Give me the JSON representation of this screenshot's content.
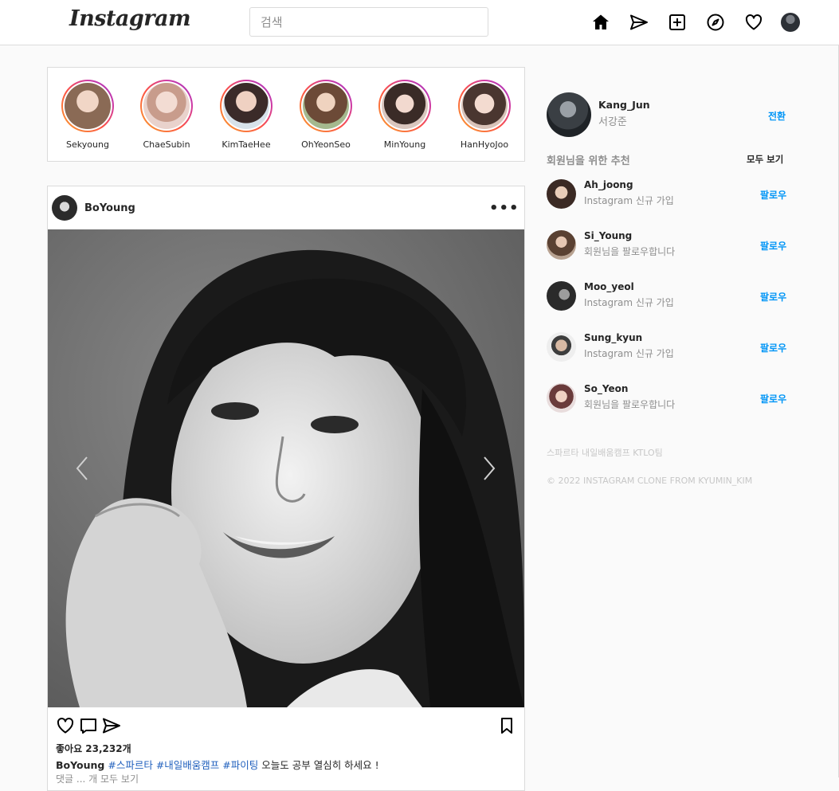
{
  "header": {
    "logo": "Instagram",
    "search_placeholder": "검색",
    "icons": [
      "home-icon",
      "direct-icon",
      "new-post-icon",
      "explore-icon",
      "activity-icon",
      "profile-avatar"
    ]
  },
  "stories": [
    {
      "name": "Sekyoung"
    },
    {
      "name": "ChaeSubin"
    },
    {
      "name": "KimTaeHee"
    },
    {
      "name": "OhYeonSeo"
    },
    {
      "name": "MinYoung"
    },
    {
      "name": "HanHyoJoo"
    }
  ],
  "post": {
    "username": "BoYoung",
    "more": "•••",
    "likes": "좋아요 23,232개",
    "caption_user": "BoYoung",
    "tags": [
      "#스파르타",
      "#내일배움캠프",
      "#파이팅"
    ],
    "caption_text": "오늘도 공부 열심히 하세요 !",
    "caption_line2": "댓글 ... 개 모두 보기"
  },
  "profile": {
    "username": "Kang_Jun",
    "name": "서강준",
    "switch": "전환"
  },
  "suggestions": {
    "title": "회원님을 위한 추천",
    "see_all": "모두 보기",
    "items": [
      {
        "username": "Ah_joong",
        "sub": "Instagram 신규 가입",
        "action": "팔로우"
      },
      {
        "username": "Si_Young",
        "sub": "회원님을 팔로우합니다",
        "action": "팔로우"
      },
      {
        "username": "Moo_yeol",
        "sub": "Instagram 신규 가입",
        "action": "팔로우"
      },
      {
        "username": "Sung_kyun",
        "sub": "Instagram 신규 가입",
        "action": "팔로우"
      },
      {
        "username": "So_Yeon",
        "sub": "회원님을 팔로우합니다",
        "action": "팔로우"
      }
    ]
  },
  "footer": {
    "line1": "스파르타 내일배움캠프 KTLO팀",
    "line2": "© 2022 INSTAGRAM CLONE FROM KYUMIN_KIM"
  },
  "colors": {
    "link": "#0095f6",
    "tag": "#1f5fbd",
    "border": "#dbdbdb",
    "muted": "#8e8e8e"
  }
}
